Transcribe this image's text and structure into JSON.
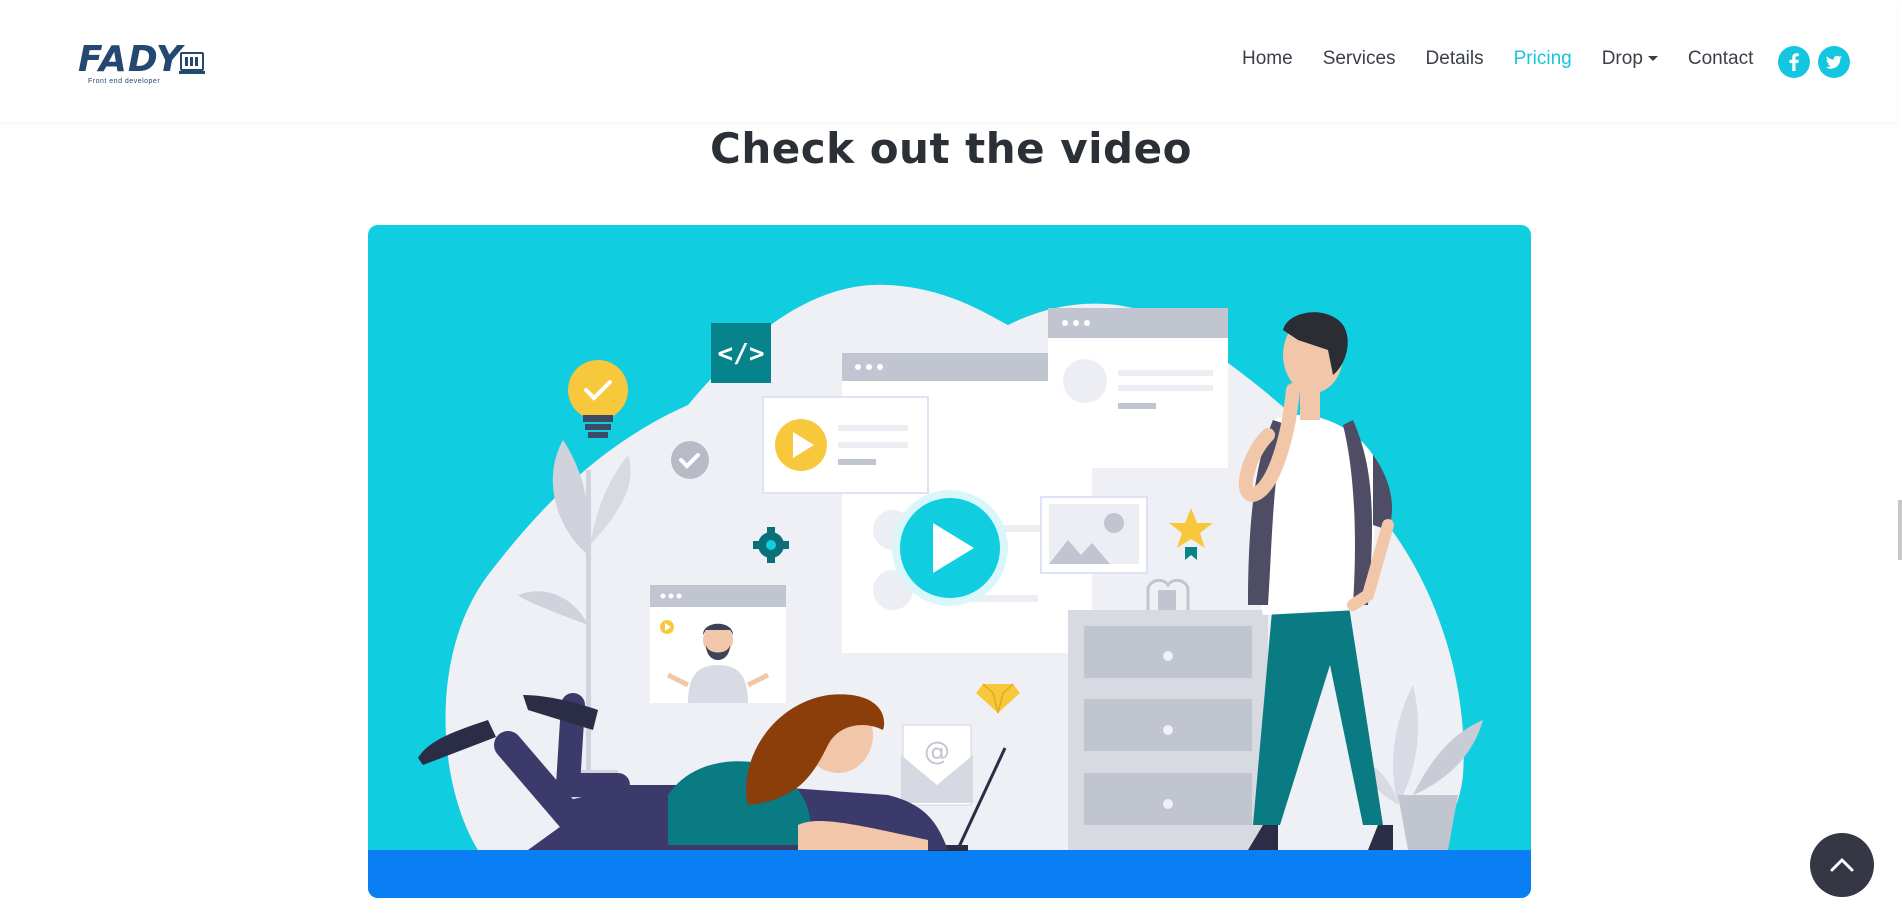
{
  "brand": {
    "name": "FADY",
    "tagline": "Front end developer"
  },
  "nav": {
    "items": [
      {
        "label": "Home"
      },
      {
        "label": "Services"
      },
      {
        "label": "Details"
      },
      {
        "label": "Pricing",
        "active": true
      },
      {
        "label": "Drop",
        "has_dropdown": true
      },
      {
        "label": "Contact"
      }
    ],
    "social": [
      {
        "icon": "facebook-icon",
        "glyph": "f"
      },
      {
        "icon": "twitter-icon",
        "glyph": "t"
      }
    ]
  },
  "section": {
    "title": "Check out the video"
  },
  "illustration": {
    "code_tag": "</>",
    "email_symbol": "@"
  },
  "colors": {
    "accent": "#14c6e0",
    "card_bg": "#10cde0",
    "floor": "#0a7ef3",
    "dark": "#363744"
  }
}
